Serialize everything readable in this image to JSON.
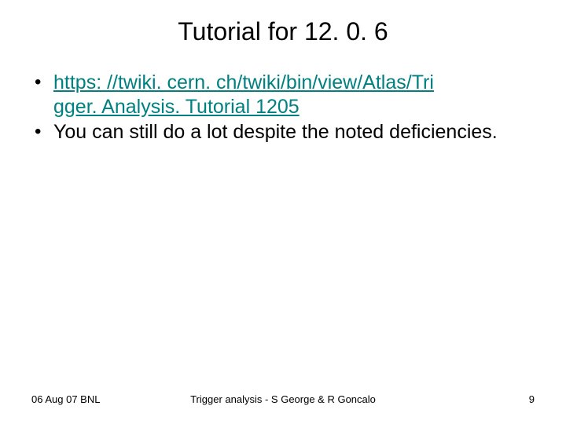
{
  "title": "Tutorial for 12. 0. 6",
  "bullets": [
    {
      "link_line1": "https: //twiki. cern. ch/twiki/bin/view/Atlas/Tri",
      "link_line2": "gger. Analysis. Tutorial 1205"
    },
    {
      "text": "You can still do a lot despite the noted deficiencies."
    }
  ],
  "footer": {
    "left": "06 Aug 07 BNL",
    "center": "Trigger analysis - S George & R Goncalo",
    "right": "9"
  }
}
